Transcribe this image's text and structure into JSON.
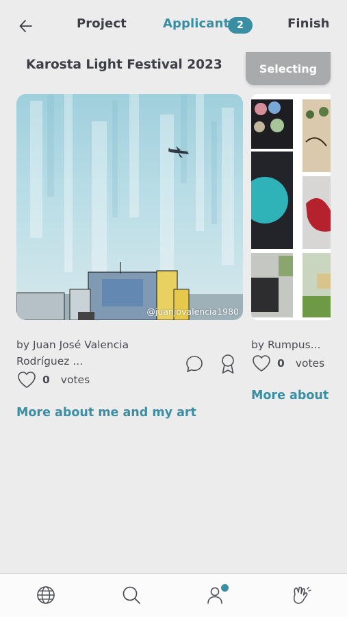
{
  "nav": {
    "project_label": "Project",
    "applicants_label": "Applicants",
    "applicants_count": "2",
    "finish_label": "Finish",
    "back_icon": "arrow-left-icon"
  },
  "project": {
    "title": "Karosta Light Festival 2023",
    "selecting_label": "Selecting"
  },
  "applicants": [
    {
      "author_line1": "by Juan José Valencia",
      "author_line2": "Rodríguez ...",
      "votes_count": "0",
      "votes_label": "votes",
      "more_link": "More about me and my art",
      "watermark": "@juanjovalencia1980"
    },
    {
      "author": "by Rumpus...",
      "votes_count": "0",
      "votes_label": "votes",
      "more_link": "More about me and my art"
    }
  ],
  "bottom_nav": {
    "items": [
      "globe-icon",
      "search-icon",
      "profile-icon",
      "hand-wave-icon"
    ]
  },
  "colors": {
    "accent": "#3a8ea3",
    "background": "#ececed",
    "selecting_bg": "#a9aaab",
    "text": "#3d3f44"
  }
}
